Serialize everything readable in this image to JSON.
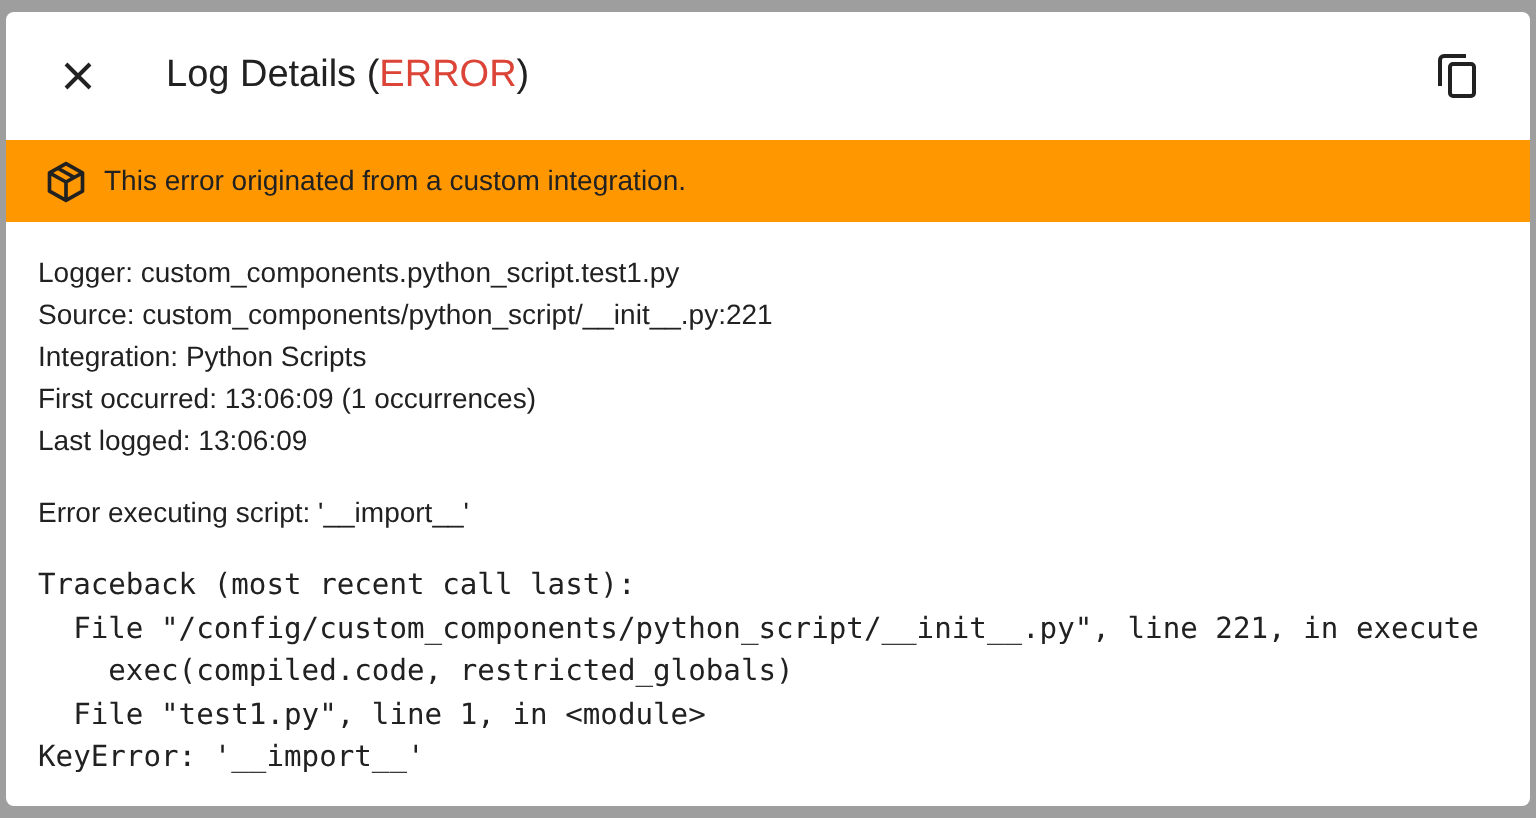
{
  "dialog": {
    "title_parts": [
      {
        "text": "Log Details (",
        "color": "#212121"
      },
      {
        "text": "ERROR",
        "color": "#db4437"
      },
      {
        "text": ")",
        "color": "#212121"
      }
    ],
    "warning_banner": "This error originated from a custom integration.",
    "details": [
      "Logger: custom_components.python_script.test1.py",
      "Source: custom_components/python_script/__init__.py:221",
      "Integration: Python Scripts",
      "First occurred: 13:06:09 (1 occurrences)",
      "Last logged: 13:06:09"
    ],
    "message": "Error executing script: '__import__'",
    "traceback": [
      "Traceback (most recent call last):",
      "  File \"/config/custom_components/python_script/__init__.py\", line 221, in execute",
      "    exec(compiled.code, restricted_globals)",
      "  File \"test1.py\", line 1, in <module>",
      "KeyError: '__import__'"
    ]
  }
}
